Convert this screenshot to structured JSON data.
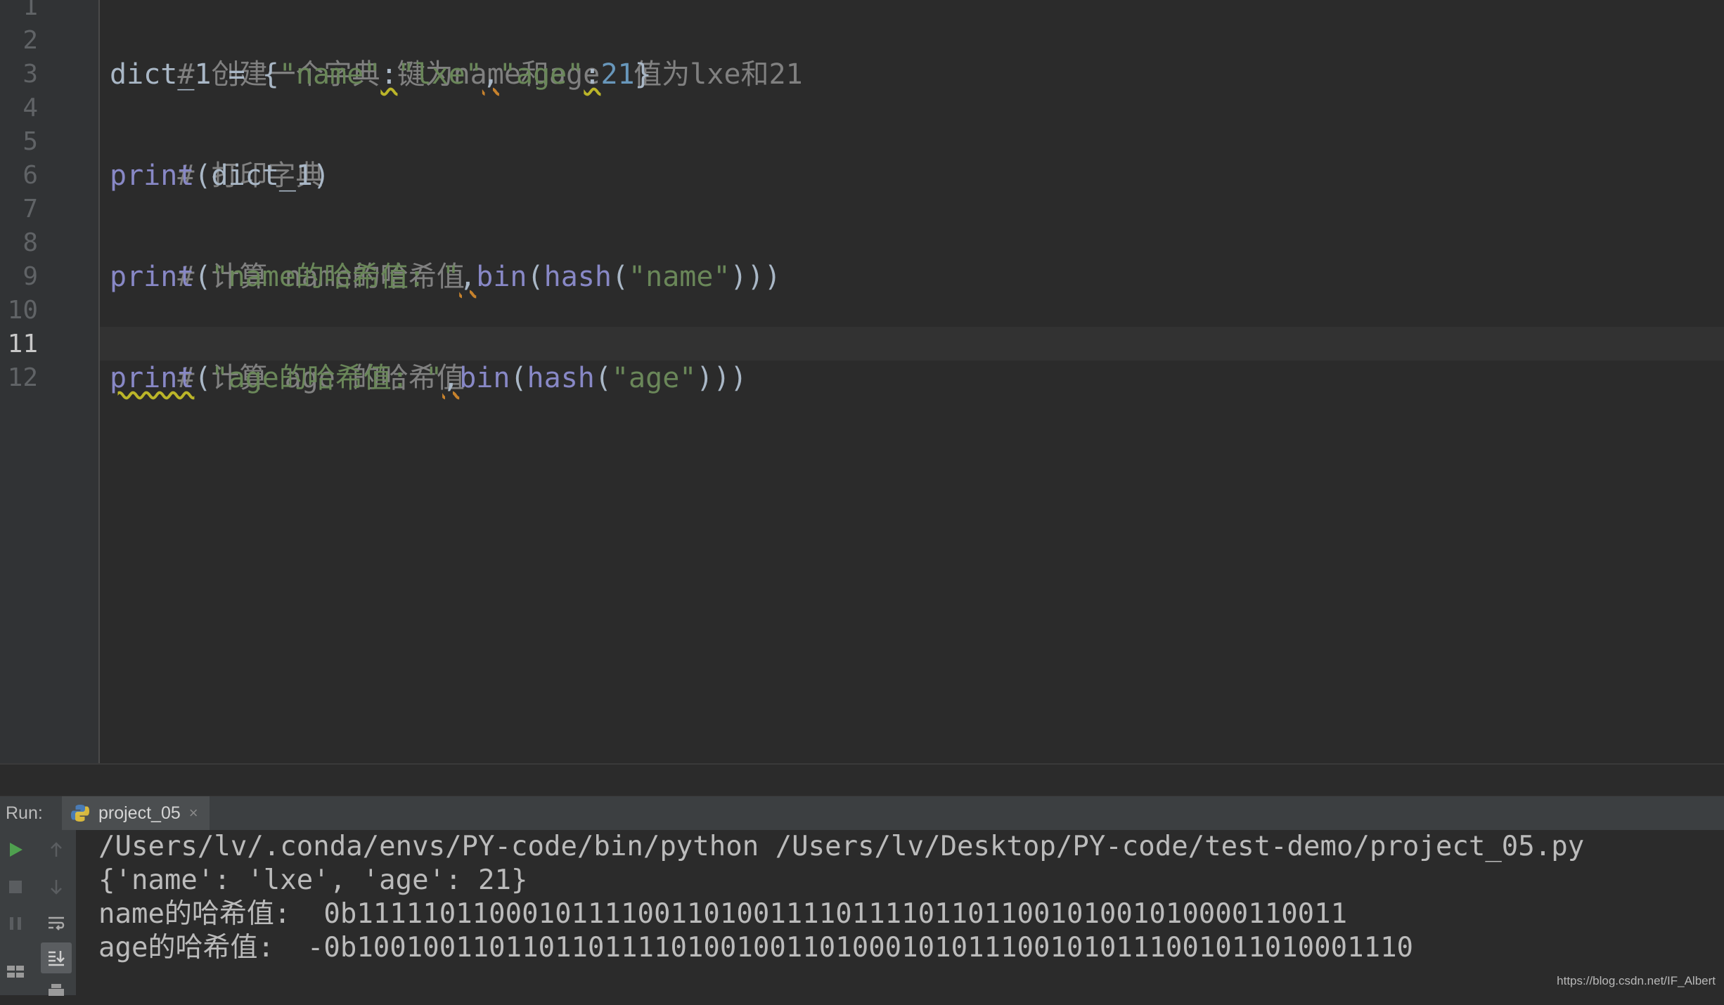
{
  "editor": {
    "line_numbers": [
      "1",
      "2",
      "3",
      "4",
      "5",
      "6",
      "7",
      "8",
      "9",
      "10",
      "11",
      "12"
    ],
    "active_line": "11",
    "lines": {
      "l2": {
        "comment": "# 创建一个字典 键为name和age  值为lxe和21"
      },
      "l3": {
        "var": "dict_1 = {",
        "k1": "\"name\"",
        "c1": ":",
        "v1": "\"lxe\"",
        "comma": ",",
        "k2": "\"age\"",
        "c2": ":",
        "v2": "21",
        "end": "}"
      },
      "l5": {
        "comment": "# 打印字典"
      },
      "l6": {
        "fn": "print",
        "args": "(dict_1)"
      },
      "l8": {
        "comment": "# 计算 name的哈希值"
      },
      "l9": {
        "fn": "print",
        "p1": "(",
        "s1": "\"name的哈希值: \"",
        "comma": ",",
        "fn2": "bin",
        "p2": "(",
        "fn3": "hash",
        "p3": "(",
        "s2": "\"name\"",
        "end": ")))"
      },
      "l11": {
        "comment": "# 计算 age 的哈希值"
      },
      "l12": {
        "fn": "print",
        "p1": "(",
        "s1": "\"age的哈希值: \"",
        "comma": ",",
        "fn2": "bin",
        "p2": "(",
        "fn3": "hash",
        "p3": "(",
        "s2": "\"age\"",
        "end": ")))"
      }
    }
  },
  "run_panel": {
    "label": "Run:",
    "tab_name": "project_05",
    "tab_close": "×",
    "icons": [
      "run-icon",
      "up-arrow-icon",
      "stop-icon",
      "down-arrow-icon",
      "pause-icon",
      "soft-wrap-icon",
      "layout-icon",
      "scroll-to-end-icon",
      "print-icon"
    ],
    "output": [
      "/Users/lv/.conda/envs/PY-code/bin/python /Users/lv/Desktop/PY-code/test-demo/project_05.py",
      "{'name': 'lxe', 'age': 21}",
      "name的哈希值:  0b1111101100010111100110100111101111011011001010010100001100​11",
      "age的哈希值:  -0b100100110110110111101001001101000101011100101011100101101000111 0"
    ]
  },
  "watermark": "https://blog.csdn.net/IF_Albert",
  "colors": {
    "comment": "#808080",
    "string": "#6a8759",
    "number": "#6897bb",
    "builtin": "#8888c6",
    "text": "#a9b7c6"
  }
}
